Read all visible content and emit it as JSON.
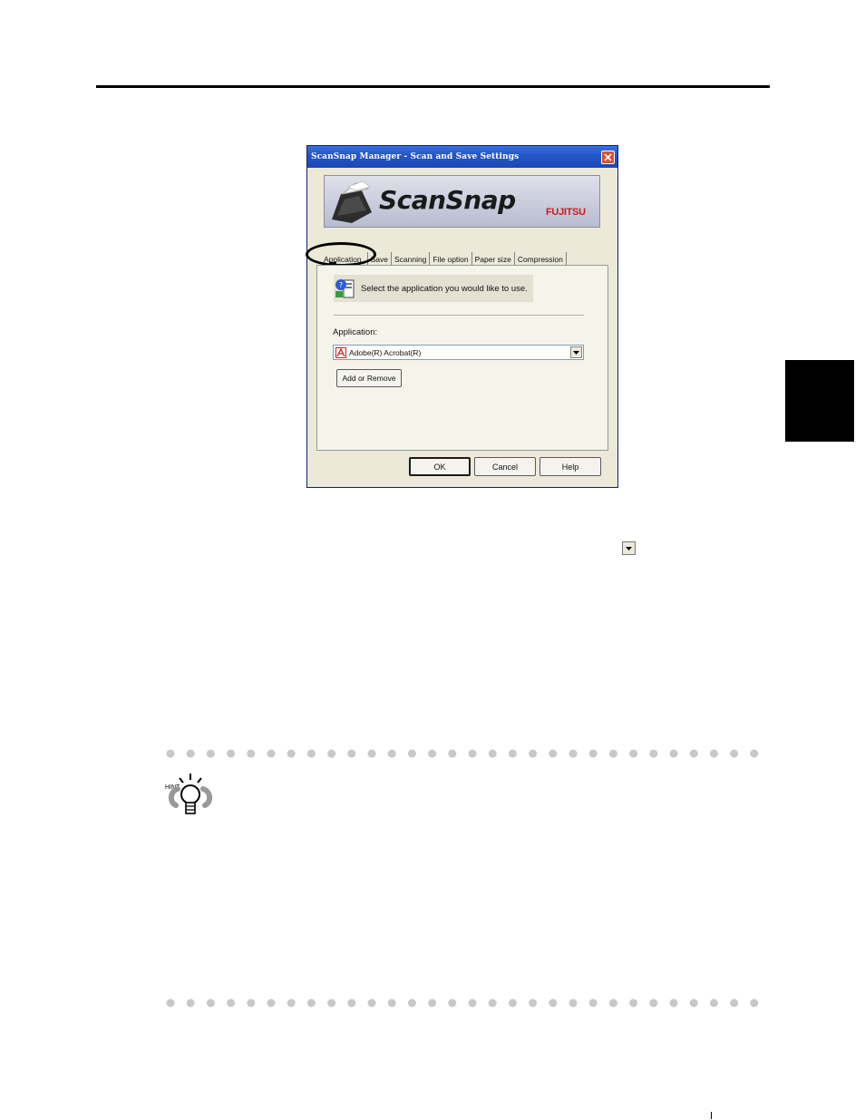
{
  "dialog": {
    "title": "ScanSnap Manager - Scan and Save Settings",
    "banner": {
      "logo": "ScanSnap",
      "brand": "FUJITSU"
    },
    "tabs": [
      {
        "label": "Application",
        "active": true
      },
      {
        "label": "Save",
        "active": false
      },
      {
        "label": "Scanning",
        "active": false
      },
      {
        "label": "File option",
        "active": false
      },
      {
        "label": "Paper size",
        "active": false
      },
      {
        "label": "Compression",
        "active": false
      }
    ],
    "instruction": "Select the application you would like to use.",
    "application_label": "Application:",
    "application_selected": "Adobe(R) Acrobat(R)",
    "add_remove_label": "Add or Remove",
    "buttons": {
      "ok": "OK",
      "cancel": "Cancel",
      "help": "Help"
    }
  },
  "hint": {
    "label": "HINT"
  },
  "icons": {
    "close": "close-icon",
    "dropdown": "chevron-down-icon",
    "hint": "lightbulb-icon",
    "application": "application-icon",
    "acrobat": "acrobat-icon",
    "scanner": "scanner-icon"
  },
  "colors": {
    "titlebar": "#2456c8",
    "close_button": "#d9502e",
    "brand_red": "#cc1d1d",
    "dialog_bg": "#ece9d8",
    "dots": "#c8c8c8"
  }
}
